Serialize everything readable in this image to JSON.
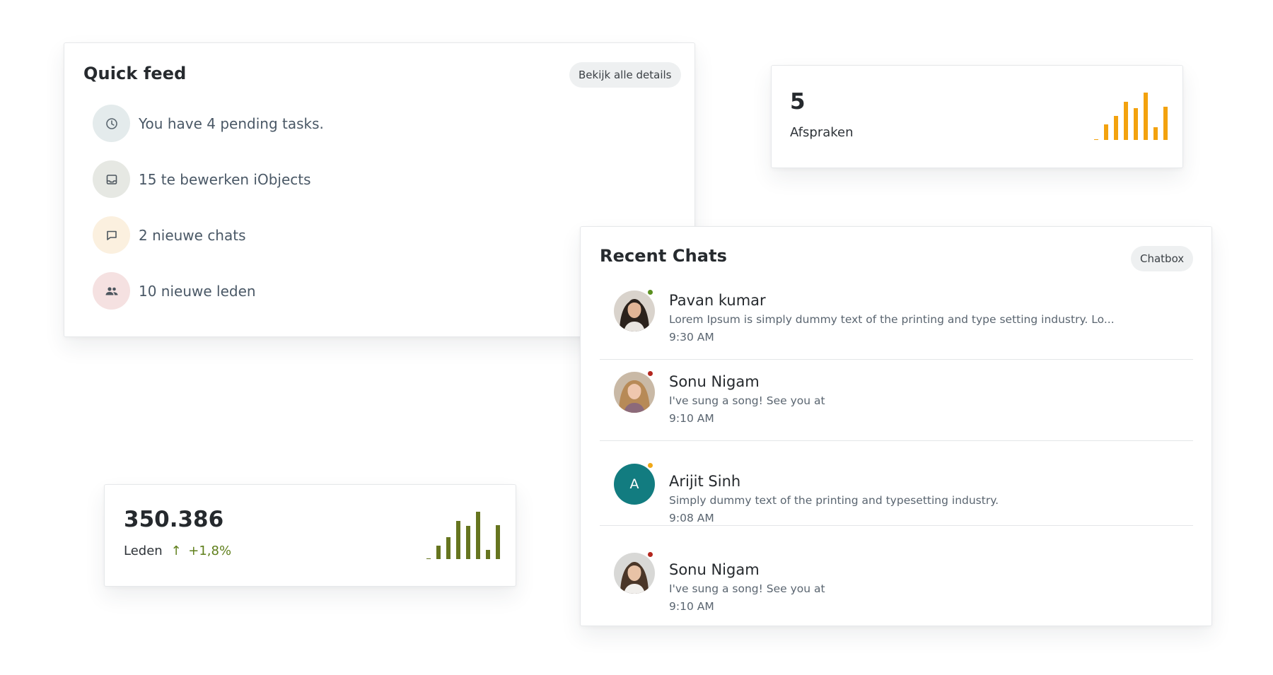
{
  "colors": {
    "orange_bars": "#f3a20e",
    "olive_bars": "#66751f",
    "trend_green": "#5f7f1b",
    "teal_avatar": "#127c80",
    "online": "#5a8f1f",
    "busy": "#b3261e",
    "away": "#f0a818"
  },
  "quick_feed": {
    "title": "Quick feed",
    "button": "Bekijk alle details",
    "items": [
      {
        "text": "You have 4 pending tasks.",
        "icon": "clock-icon",
        "bg": "#e4ebec"
      },
      {
        "text": "15 te bewerken iObjects",
        "icon": "inbox-icon",
        "bg": "#e6e8e3"
      },
      {
        "text": "2 nieuwe chats",
        "icon": "chat-bubble-icon",
        "bg": "#fbf0df"
      },
      {
        "text": "10 nieuwe leden",
        "icon": "people-icon",
        "bg": "#f5e1e1"
      }
    ]
  },
  "afspraken": {
    "value": "5",
    "label": "Afspraken",
    "bars": [
      0.02,
      0.33,
      0.5,
      0.8,
      0.67,
      1.0,
      0.27,
      0.7
    ]
  },
  "leden": {
    "value": "350.386",
    "label": "Leden",
    "trend_arrow": "↑",
    "trend": "+1,8%",
    "bars": [
      0.02,
      0.28,
      0.47,
      0.8,
      0.7,
      1.0,
      0.2,
      0.72
    ]
  },
  "recent_chats": {
    "title": "Recent Chats",
    "button": "Chatbox",
    "chats": [
      {
        "name": "Pavan kumar",
        "message": "Lorem Ipsum is simply dummy text of the printing and type setting industry. Lo...",
        "time": "9:30 AM",
        "status": "online",
        "avatar": "photo"
      },
      {
        "name": "Sonu Nigam",
        "message": "I've sung a song! See you at",
        "time": "9:10 AM",
        "status": "busy",
        "avatar": "photo"
      },
      {
        "name": "Arijit Sinh",
        "message": "Simply dummy text of the printing and typesetting industry.",
        "time": "9:08 AM",
        "status": "away",
        "avatar": "letter",
        "initial": "A"
      },
      {
        "name": "Sonu Nigam",
        "message": "I've sung a song! See you at",
        "time": "9:10 AM",
        "status": "busy",
        "avatar": "photo"
      }
    ]
  }
}
